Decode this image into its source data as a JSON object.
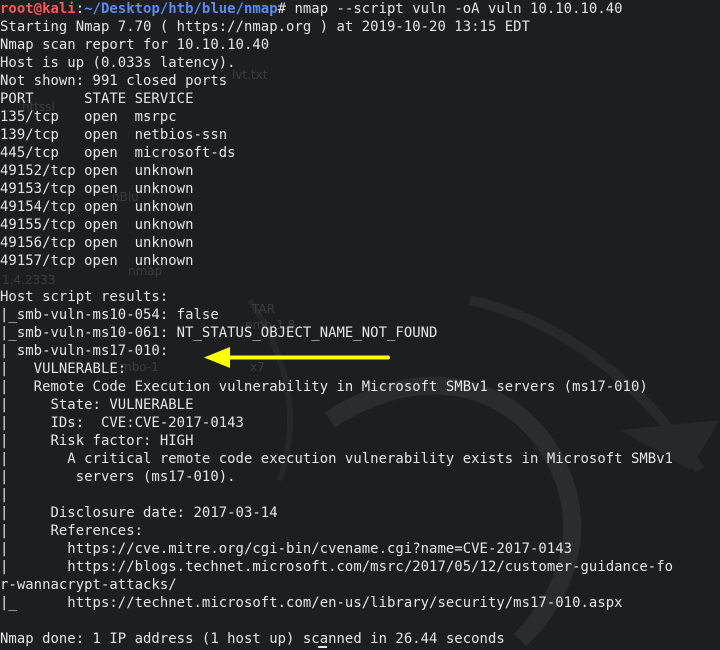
{
  "prompt": {
    "user": "root@kali",
    "sep": ":",
    "path": "~/Desktop/htb/blue/nmap",
    "symbol": "# ",
    "command": "nmap --script vuln -oA vuln 10.10.10.40"
  },
  "lines": [
    "Starting Nmap 7.70 ( https://nmap.org ) at 2019-10-20 13:15 EDT",
    "Nmap scan report for 10.10.10.40",
    "Host is up (0.033s latency).",
    "Not shown: 991 closed ports",
    "PORT      STATE SERVICE",
    "135/tcp   open  msrpc",
    "139/tcp   open  netbios-ssn",
    "445/tcp   open  microsoft-ds",
    "49152/tcp open  unknown",
    "49153/tcp open  unknown",
    "49154/tcp open  unknown",
    "49155/tcp open  unknown",
    "49156/tcp open  unknown",
    "49157/tcp open  unknown",
    "",
    "Host script results:",
    "|_smb-vuln-ms10-054: false",
    "|_smb-vuln-ms10-061: NT_STATUS_OBJECT_NAME_NOT_FOUND",
    "| smb-vuln-ms17-010:",
    "|   VULNERABLE:",
    "|   Remote Code Execution vulnerability in Microsoft SMBv1 servers (ms17-010)",
    "|     State: VULNERABLE",
    "|     IDs:  CVE:CVE-2017-0143",
    "|     Risk factor: HIGH",
    "|       A critical remote code execution vulnerability exists in Microsoft SMBv1",
    "|        servers (ms17-010).",
    "|",
    "|     Disclosure date: 2017-03-14",
    "|     References:",
    "|       https://cve.mitre.org/cgi-bin/cvename.cgi?name=CVE-2017-0143",
    "|       https://blogs.technet.microsoft.com/msrc/2017/05/12/customer-guidance-fo",
    "r-wannacrypt-attacks/",
    "|_      https://technet.microsoft.com/en-us/library/security/ms17-010.aspx",
    "",
    "Nmap done: 1 IP address (1 host up) scanned in 26.44 seconds"
  ],
  "desktop_ghosts": {
    "items": [
      "lvt.txt",
      "httssl",
      "nBlu",
      "1.4.2333",
      "TAR",
      "nmap",
      "pmb-1.8",
      "mbo-1",
      "x7"
    ]
  },
  "annotation": {
    "arrow_icon": "yellow-arrow-left-icon",
    "color": "#ffff00"
  },
  "colors": {
    "background": "#1c1e20",
    "text": "#e6e6e6",
    "user": "#ff5555",
    "path": "#5c8cf0"
  }
}
